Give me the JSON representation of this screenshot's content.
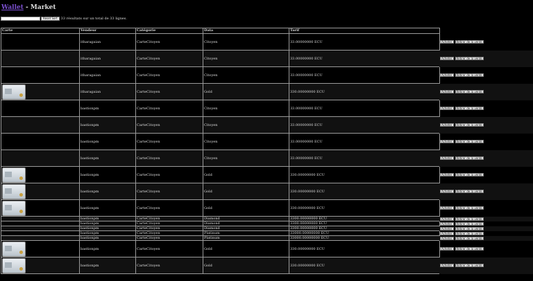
{
  "header": {
    "link": "Wallet",
    "separator": " - ",
    "title": "Market"
  },
  "search": {
    "value": "",
    "reset_label": "Reset Sort",
    "result_text": "33 résultats sur un total de 33 lignes."
  },
  "table": {
    "columns": [
      "Carte",
      "Vendeur",
      "Catégorie",
      "Data",
      "Tarif"
    ],
    "rows": [
      {
        "card": "strip",
        "seller": "itharagaian",
        "category": "CarteCitoyen",
        "data": "Citoyen",
        "price": "33.00000000 ECU",
        "size": "tall"
      },
      {
        "card": "strip",
        "seller": "itharagaian",
        "category": "CarteCitoyen",
        "data": "Citoyen",
        "price": "33.00000000 ECU",
        "size": "tall"
      },
      {
        "card": "strip",
        "seller": "itharagaian",
        "category": "CarteCitoyen",
        "data": "Citoyen",
        "price": "33.00000000 ECU",
        "size": "tall"
      },
      {
        "card": "image",
        "seller": "itharagaian",
        "category": "CarteCitoyen",
        "data": "Gold",
        "price": "330.00000000 ECU",
        "size": "tall"
      },
      {
        "card": "strip",
        "seller": "bastionpm",
        "category": "CarteCitoyen",
        "data": "Citoyen",
        "price": "33.00000000 ECU",
        "size": "tall"
      },
      {
        "card": "strip",
        "seller": "bastionpm",
        "category": "CarteCitoyen",
        "data": "Citoyen",
        "price": "33.00000000 ECU",
        "size": "tall"
      },
      {
        "card": "strip",
        "seller": "bastionpm",
        "category": "CarteCitoyen",
        "data": "Citoyen",
        "price": "33.00000000 ECU",
        "size": "tall"
      },
      {
        "card": "strip",
        "seller": "bastionpm",
        "category": "CarteCitoyen",
        "data": "Citoyen",
        "price": "33.00000000 ECU",
        "size": "tall"
      },
      {
        "card": "image",
        "seller": "bastionpm",
        "category": "CarteCitoyen",
        "data": "Gold",
        "price": "330.00000000 ECU",
        "size": "tall"
      },
      {
        "card": "image",
        "seller": "bastionpm",
        "category": "CarteCitoyen",
        "data": "Gold",
        "price": "330.00000000 ECU",
        "size": "tall"
      },
      {
        "card": "image",
        "seller": "bastionpm",
        "category": "CarteCitoyen",
        "data": "Gold",
        "price": "330.00000000 ECU",
        "size": "tall"
      },
      {
        "card": "none",
        "seller": "bastionpm",
        "category": "CarteCitoyen",
        "data": "Diamond",
        "price": "3300.00000000 ECU",
        "size": "short"
      },
      {
        "card": "none",
        "seller": "bastionpm",
        "category": "CarteCitoyen",
        "data": "Diamond",
        "price": "3300.00000000 ECU",
        "size": "short"
      },
      {
        "card": "none",
        "seller": "bastionpm",
        "category": "CarteCitoyen",
        "data": "Diamond",
        "price": "3300.00000000 ECU",
        "size": "short"
      },
      {
        "card": "none",
        "seller": "bastionpm",
        "category": "CarteCitoyen",
        "data": "Platinum",
        "price": "33000.00000000 ECU",
        "size": "short"
      },
      {
        "card": "none",
        "seller": "bastionpm",
        "category": "CarteCitoyen",
        "data": "Platinum",
        "price": "33000.00000000 ECU",
        "size": "short"
      },
      {
        "card": "image",
        "seller": "bastionpm",
        "category": "CarteCitoyen",
        "data": "Gold",
        "price": "330.00000000 ECU",
        "size": "tall"
      },
      {
        "card": "image",
        "seller": "bastionpm",
        "category": "CarteCitoyen",
        "data": "Gold",
        "price": "330.00000000 ECU",
        "size": "tall"
      }
    ]
  },
  "actions": {
    "buy_label": "Acheter",
    "withdraw_label": "Retirer de la vente"
  },
  "colors": {
    "link": "#7b4fd0",
    "background": "#000000",
    "row_alt": "#111111"
  }
}
